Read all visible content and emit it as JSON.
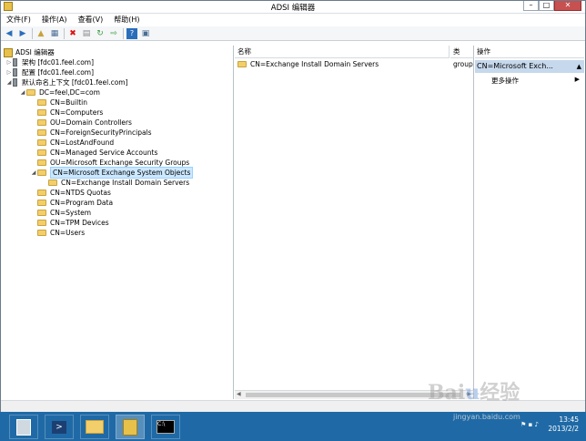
{
  "window": {
    "title": "ADSI 编辑器"
  },
  "menubar": [
    "文件(F)",
    "操作(A)",
    "查看(V)",
    "帮助(H)"
  ],
  "tree": {
    "root": "ADSI 编辑器",
    "schema": "架构 [fdc01.feel.com]",
    "config": "配置 [fdc01.feel.com]",
    "default_naming": "默认命名上下文 [fdc01.feel.com]",
    "domain": "DC=feel,DC=com",
    "children": [
      "CN=Builtin",
      "CN=Computers",
      "OU=Domain Controllers",
      "CN=ForeignSecurityPrincipals",
      "CN=LostAndFound",
      "CN=Managed Service Accounts",
      "OU=Microsoft Exchange Security Groups",
      "CN=Microsoft Exchange System Objects",
      "CN=Exchange Install Domain Servers",
      "CN=NTDS Quotas",
      "CN=Program Data",
      "CN=System",
      "CN=TPM Devices",
      "CN=Users"
    ]
  },
  "list": {
    "col_name": "名称",
    "col_type": "类",
    "rows": [
      {
        "name": "CN=Exchange Install Domain Servers",
        "type": "group"
      }
    ]
  },
  "actions": {
    "header": "操作",
    "selected": "CN=Microsoft Exch...",
    "more": "更多操作"
  },
  "taskbar": {
    "time": "13:45",
    "date": "2013/2/2"
  },
  "watermark": {
    "logo": "Baidu 经验",
    "url": "jingyan.baidu.com"
  }
}
